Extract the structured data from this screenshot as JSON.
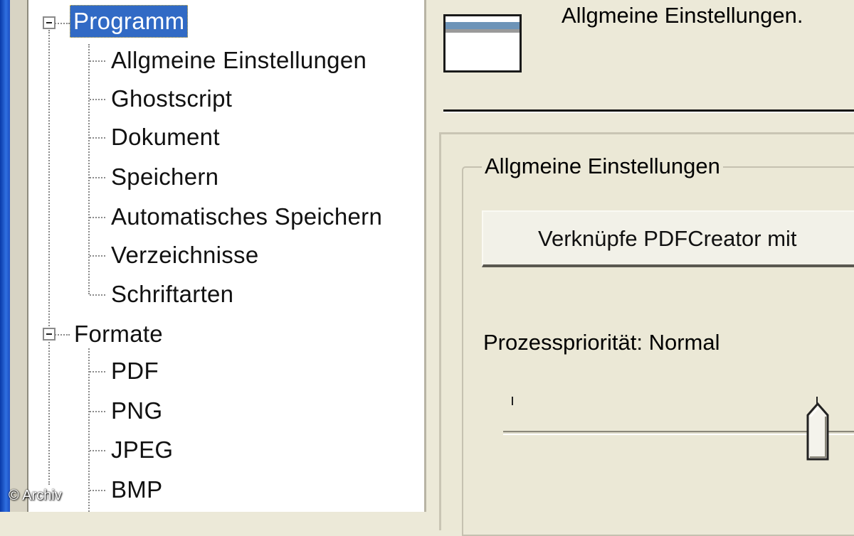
{
  "tree": {
    "programm": {
      "label": "Programm",
      "children": [
        "Allgmeine Einstellungen",
        "Ghostscript",
        "Dokument",
        "Speichern",
        "Automatisches Speichern",
        "Verzeichnisse",
        "Schriftarten"
      ]
    },
    "formate": {
      "label": "Formate",
      "children": [
        "PDF",
        "PNG",
        "JPEG",
        "BMP"
      ]
    }
  },
  "header": {
    "title": "Allgmeine Einstellungen."
  },
  "group": {
    "title": "Allgmeine Einstellungen",
    "assoc_button_label": "Verknüpfe PDFCreator mit",
    "priority_label": "Prozesspriorität: Normal",
    "priority_level": 0.67
  },
  "watermark": "© Archiv",
  "colors": {
    "selection": "#316ac5",
    "window_bg": "#ece9d8",
    "tree_bg": "#ffffff"
  },
  "icons": {
    "expander": "minus-box-icon",
    "header": "window-settings-icon"
  }
}
